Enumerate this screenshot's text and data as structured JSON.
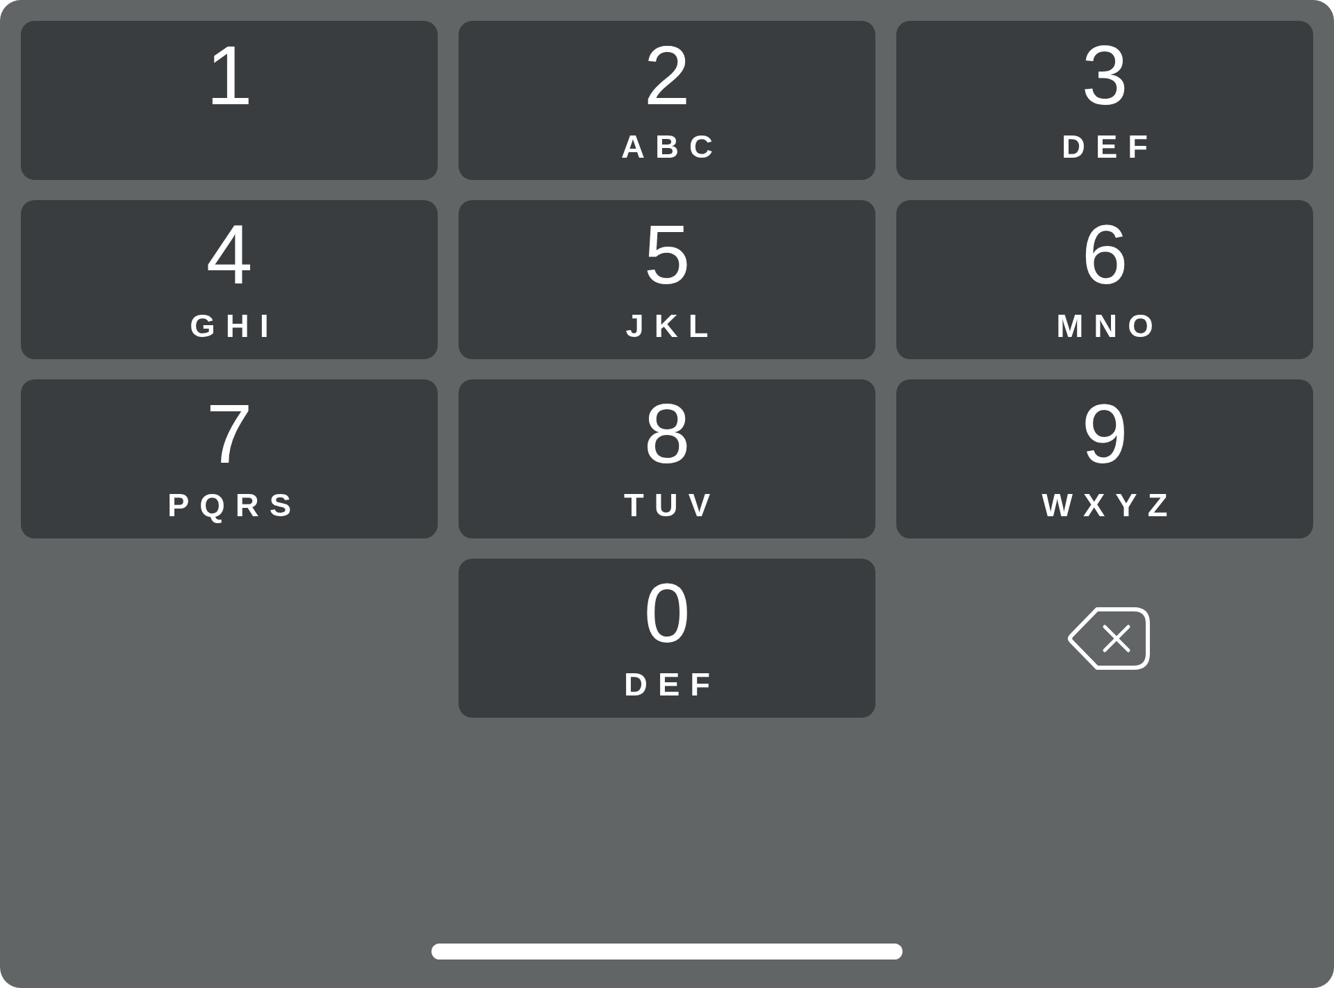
{
  "keypad": {
    "keys": [
      {
        "kind": "digit",
        "digit": "1"
      },
      {
        "kind": "digit",
        "digit": "2",
        "letters": "ABC"
      },
      {
        "kind": "digit",
        "digit": "3",
        "letters": "DEF"
      },
      {
        "kind": "digit",
        "digit": "4",
        "letters": "GHI"
      },
      {
        "kind": "digit",
        "digit": "5",
        "letters": "JKL"
      },
      {
        "kind": "digit",
        "digit": "6",
        "letters": "MNO"
      },
      {
        "kind": "digit",
        "digit": "7",
        "letters": "PQRS"
      },
      {
        "kind": "digit",
        "digit": "8",
        "letters": "TUV"
      },
      {
        "kind": "digit",
        "digit": "9",
        "letters": "WXYZ"
      },
      {
        "kind": "spacer"
      },
      {
        "kind": "digit",
        "digit": "0",
        "letters": "DEF"
      },
      {
        "kind": "delete"
      }
    ]
  }
}
